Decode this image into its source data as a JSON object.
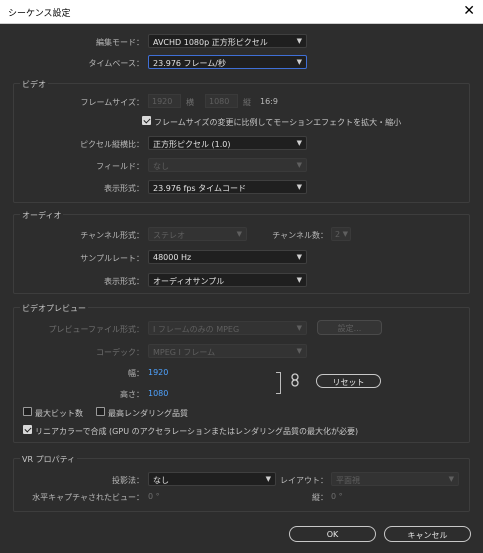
{
  "window": {
    "title": "シーケンス設定",
    "close_glyph": "✕"
  },
  "top": {
    "edit_mode_label": "編集モード：",
    "edit_mode_value": "AVCHD 1080p 正方形ピクセル",
    "timebase_label": "タイムベース：",
    "timebase_value": "23.976 フレーム/秒"
  },
  "video": {
    "title": "ビデオ",
    "frame_size_label": "フレームサイズ：",
    "frame_width": "1920",
    "width_label": "横",
    "frame_height": "1080",
    "height_label": "縦",
    "aspect": "16:9",
    "scale_motion_label": "フレームサイズの変更に比例してモーションエフェクトを拡大・縮小",
    "pixel_aspect_label": "ピクセル縦横比：",
    "pixel_aspect_value": "正方形ピクセル (1.0)",
    "field_label": "フィールド：",
    "field_value": "なし",
    "display_format_label": "表示形式：",
    "display_format_value": "23.976 fps タイムコード"
  },
  "audio": {
    "title": "オーディオ",
    "channel_format_label": "チャンネル形式：",
    "channel_format_value": "ステレオ",
    "channel_count_label": "チャンネル数：",
    "channel_count_value": "2",
    "sample_rate_label": "サンプルレート：",
    "sample_rate_value": "48000 Hz",
    "display_format_label": "表示形式：",
    "display_format_value": "オーディオサンプル"
  },
  "preview": {
    "title": "ビデオプレビュー",
    "file_format_label": "プレビューファイル形式：",
    "file_format_value": "I フレームのみの MPEG",
    "settings_button": "設定...",
    "codec_label": "コーデック：",
    "codec_value": "MPEG I フレーム",
    "width_label": "幅：",
    "width_value": "1920",
    "height_label": "高さ：",
    "height_value": "1080",
    "reset_button": "リセット",
    "max_bit_depth_label": "最大ビット数",
    "max_render_quality_label": "最高レンダリング品質",
    "linear_color_label": "リニアカラーで合成 (GPU のアクセラレーションまたはレンダリング品質の最大化が必要)"
  },
  "vr": {
    "title": "VR プロパティ",
    "projection_label": "投影法：",
    "projection_value": "なし",
    "layout_label": "レイアウト：",
    "layout_value": "平面視",
    "h_view_label": "水平キャプチャされたビュー：",
    "h_view_value": "0 °",
    "v_label": "縦：",
    "v_value": "0 °"
  },
  "buttons": {
    "ok": "OK",
    "cancel": "キャンセル"
  },
  "colors": {
    "accent_blue": "#4fa3ff",
    "focus_border": "#3f6fd6",
    "background": "#2d2d2d"
  },
  "icons": {
    "dropdown": "chevron-down-icon",
    "link": "link-icon",
    "close": "close-icon"
  }
}
